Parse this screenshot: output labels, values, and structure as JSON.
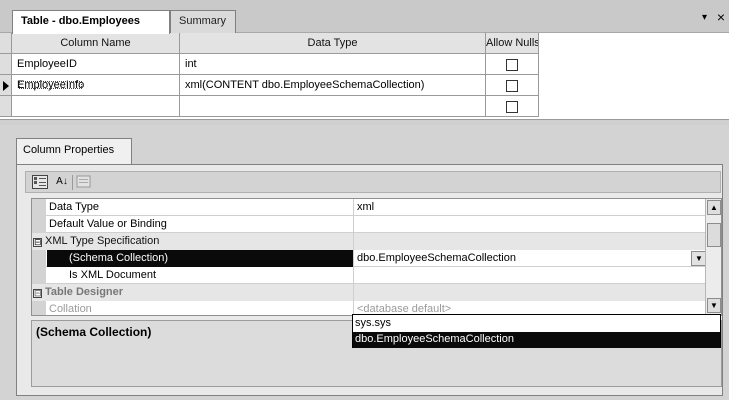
{
  "tabs": {
    "table": "Table - dbo.Employees",
    "summary": "Summary",
    "menu_glyph": "▾",
    "close_glyph": "×"
  },
  "column_grid": {
    "headers": [
      "Column Name",
      "Data Type",
      "Allow Nulls"
    ],
    "rows": [
      {
        "name": "EmployeeID",
        "type": "int",
        "allow_nulls": false
      },
      {
        "name": "EmployeeInfo",
        "type": "xml(CONTENT dbo.EmployeeSchemaCollection)",
        "allow_nulls": false
      },
      {
        "name": "",
        "type": "",
        "allow_nulls": false
      }
    ]
  },
  "properties": {
    "tab_label": "Column Properties",
    "toolbar": {
      "categorized_icon": "categorized-icon",
      "alphabetical_label": "A↓",
      "pages_icon": "property-pages-icon"
    },
    "rows": [
      {
        "name": "Data Type",
        "value": "xml"
      },
      {
        "name": "Default Value or Binding",
        "value": ""
      },
      {
        "name": "XML Type Specification",
        "value": "",
        "expander": "⊟"
      },
      {
        "name": "(Schema Collection)",
        "value": "dbo.EmployeeSchemaCollection"
      },
      {
        "name": "Is XML Document",
        "value": ""
      },
      {
        "name": "Table Designer",
        "value": "",
        "expander": "⊟"
      },
      {
        "name": "Collation",
        "value": "<database default>"
      }
    ],
    "dropdown_options": [
      "sys.sys",
      "dbo.EmployeeSchemaCollection"
    ],
    "description_title": "(Schema Collection)"
  },
  "colors": {
    "selection": "#0a0a0a",
    "panel": "#d3d3d3"
  }
}
